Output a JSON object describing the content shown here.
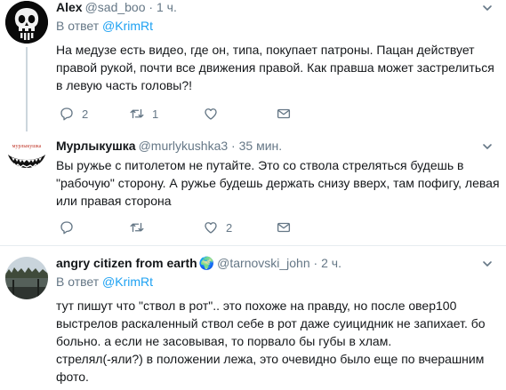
{
  "tweets": [
    {
      "name": "Alex",
      "handle": "@sad_boo",
      "sep": "·",
      "time": "1 ч.",
      "replying_prefix": "В ответ",
      "replying_to": "@KrimRt",
      "text_lines": [
        "На медузе есть видео, где он, типа, покупает патроны. Пацан действует",
        "правой рукой, почти все движения правой. Как правша может застрелиться",
        "в левую часть головы?!"
      ],
      "reply_count": "2",
      "retweet_count": "1",
      "like_count": ""
    },
    {
      "name": "Мурлыкушка",
      "handle": "@murlykushka3",
      "sep": "·",
      "time": "35 мин.",
      "avatar_text": "мурлыкушка",
      "text_lines": [
        "Вы ружье с питолетом не путайте. Это со ствола стреляться будешь в",
        "\"рабочую\" сторону. А ружье будешь держать снизу вверх, там пофигу, левая",
        "или правая сторона"
      ],
      "reply_count": "",
      "retweet_count": "",
      "like_count": "2"
    },
    {
      "name": "angry citizen from earth",
      "name_emoji": "🌍",
      "handle": "@tarnovski_john",
      "sep": "·",
      "time": "2 ч.",
      "replying_prefix": "В ответ",
      "replying_to": "@KrimRt",
      "text_lines": [
        "тут пишут что \"ствол в рот\".. это похоже на правду, но после овер100",
        "выстрелов раскаленный ствол себе в рот даже суицидник не запихает. бо",
        "больно. а если не засовывая, то порвало бы губы в хлам.",
        "стрелял(-яли?) в положении лежа, это очевидно было еще по вчерашним",
        "фото."
      ]
    }
  ],
  "colors": {
    "accent": "#1da1f2",
    "secondary_text": "#657786",
    "divider": "#e6ecf0"
  }
}
